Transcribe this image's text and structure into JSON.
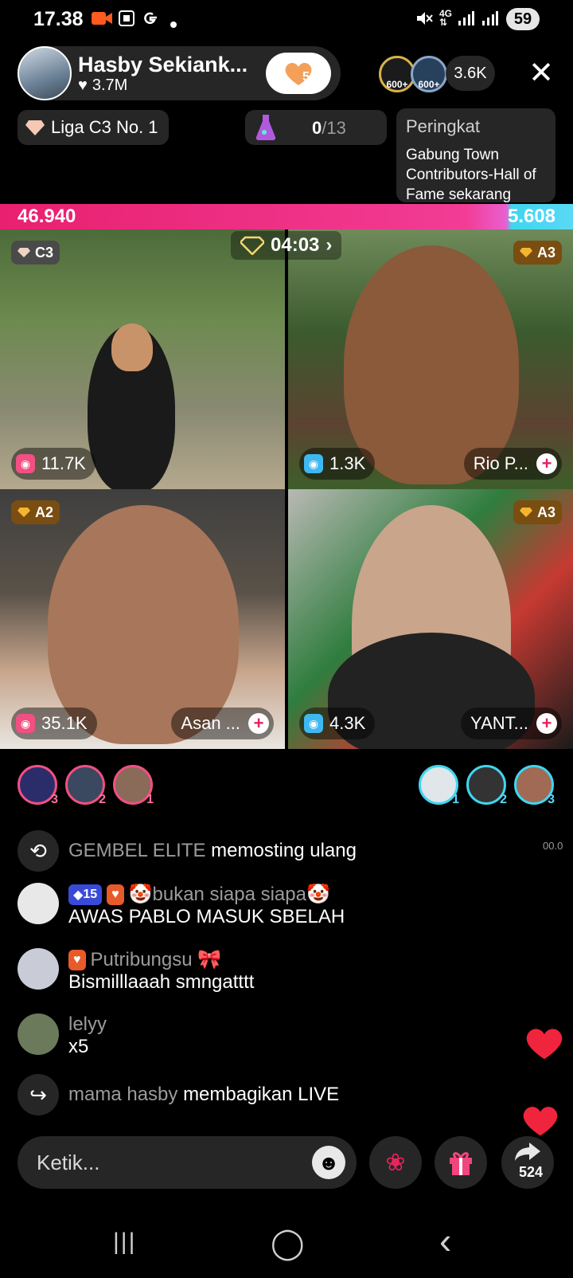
{
  "status": {
    "time": "17.38",
    "notif_icons": [
      "video-record-icon",
      "screenshot-icon",
      "google-icon",
      "dot-icon"
    ],
    "right_icons": [
      "mute-icon",
      "4g-icon",
      "signal-icon",
      "signal-icon"
    ],
    "battery": "59"
  },
  "host": {
    "name": "Hasby Sekiank...",
    "likes": "3.7M",
    "follow_count": "5",
    "top_viewer_badges": [
      "600+",
      "600+"
    ],
    "viewer_count": "3.6K",
    "close": "✕"
  },
  "league": {
    "label": "Liga C3 No. 1"
  },
  "progress": {
    "current": "0",
    "total": "/13"
  },
  "ranking": {
    "title": "Peringkat",
    "desc": "Gabung Town Contributors-Hall of Fame sekarang"
  },
  "battle": {
    "left_score": "46.940",
    "right_score": "5.608",
    "left_fraction": 0.893
  },
  "timer": "04:03",
  "tiles": [
    {
      "rank": "C3",
      "score": "11.7K",
      "name": "",
      "score_color": "#f24f82"
    },
    {
      "rank": "A3",
      "score": "1.3K",
      "name": "Rio P...",
      "score_color": "#3fb8f0"
    },
    {
      "rank": "A2",
      "score": "35.1K",
      "name": "Asan ...",
      "score_color": "#f24f82"
    },
    {
      "rank": "A3",
      "score": "4.3K",
      "name": "YANT...",
      "score_color": "#3fb8f0"
    }
  ],
  "left_rankers": [
    "3",
    "2",
    "1"
  ],
  "right_rankers": [
    "1",
    "2",
    "3"
  ],
  "side_timer": "00.0",
  "chat": [
    {
      "type": "system",
      "icon": "repost-icon",
      "user": "GEMBEL ELITE",
      "text": "memosting ulang"
    },
    {
      "type": "msg",
      "level": "15",
      "user": "🤡bukan siapa siapa🤡",
      "text": "AWAS PABLO MASUK SBELAH"
    },
    {
      "type": "msg",
      "user": "Putribungsu 🎀",
      "text": "Bismilllaaah smngatttt"
    },
    {
      "type": "msg",
      "user": "lelyy",
      "text": "x5"
    },
    {
      "type": "system",
      "icon": "share-icon",
      "user": "mama hasby",
      "text": "membagikan LIVE"
    }
  ],
  "input": {
    "placeholder": "Ketik..."
  },
  "share_count": "524",
  "nav": {
    "recents": "|||",
    "home": "◯",
    "back": "‹"
  }
}
